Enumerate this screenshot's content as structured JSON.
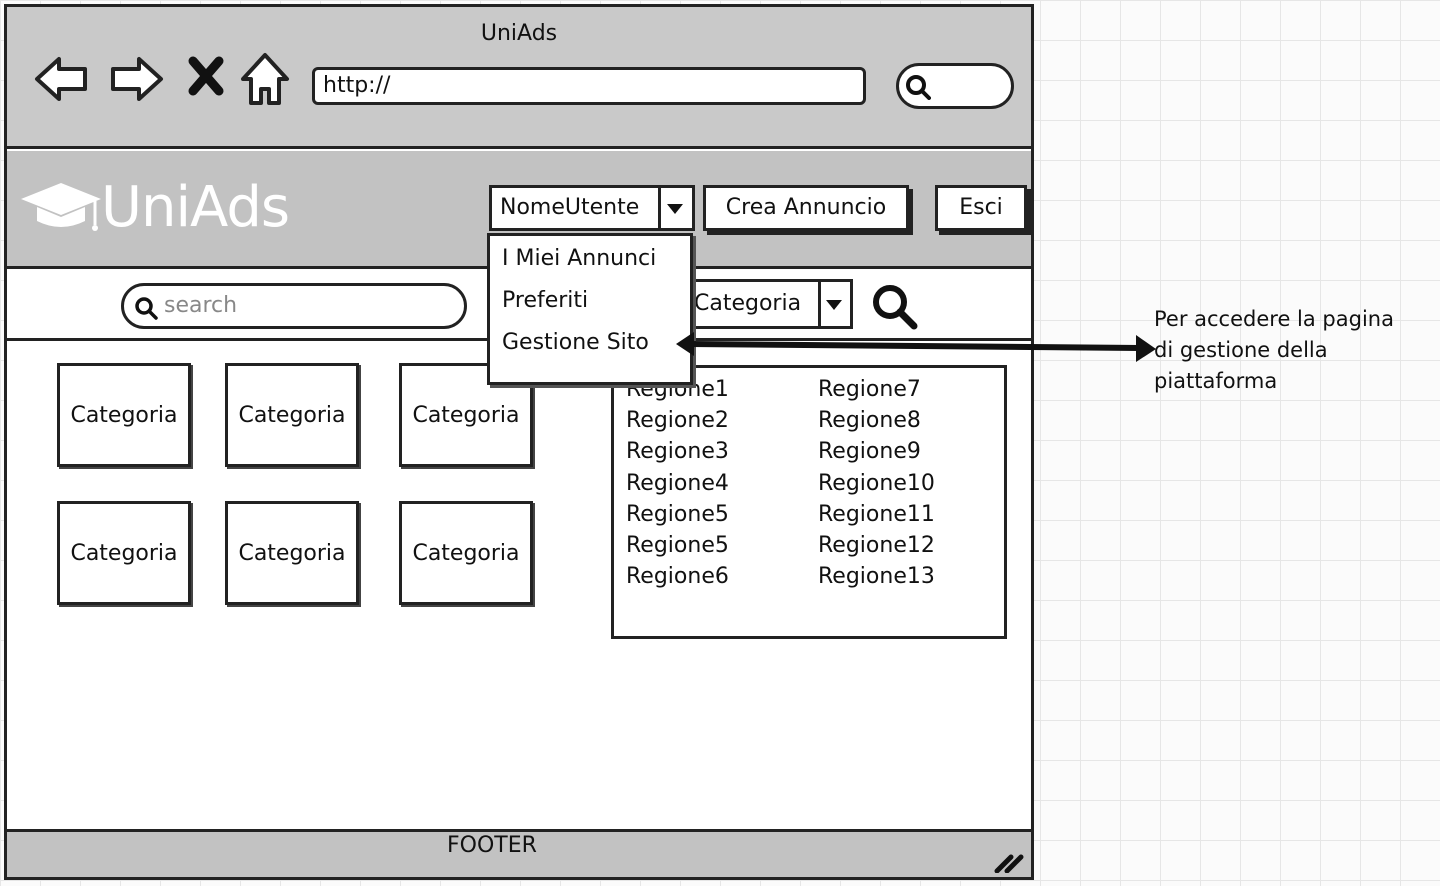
{
  "window": {
    "title": "UniAds"
  },
  "browser": {
    "url": "http://",
    "icons": [
      "back-icon",
      "forward-icon",
      "close-icon",
      "home-icon",
      "search-icon"
    ]
  },
  "header": {
    "logo_text": "UniAds",
    "user_menu": {
      "label": "NomeUtente"
    },
    "create_button": "Crea Annuncio",
    "logout_button": "Esci"
  },
  "dropdown": {
    "items": [
      "I Miei Annunci",
      "Preferiti",
      "Gestione Sito"
    ]
  },
  "search": {
    "placeholder": "search",
    "category_select": "Categoria"
  },
  "categories": [
    "Categoria",
    "Categoria",
    "Categoria",
    "Categoria",
    "Categoria",
    "Categoria"
  ],
  "regions": {
    "col1": [
      "Regione1",
      "Regione2",
      "Regione3",
      "Regione4",
      "Regione5",
      "Regione5",
      "Regione6"
    ],
    "col2": [
      "Regione7",
      "Regione8",
      "Regione9",
      "Regione10",
      "Regione11",
      "Regione12",
      "Regione13"
    ]
  },
  "footer": {
    "label": "FOOTER"
  },
  "annotation": {
    "line1": "Per accedere la pagina",
    "line2": "di gestione della",
    "line3": "piattaforma"
  }
}
